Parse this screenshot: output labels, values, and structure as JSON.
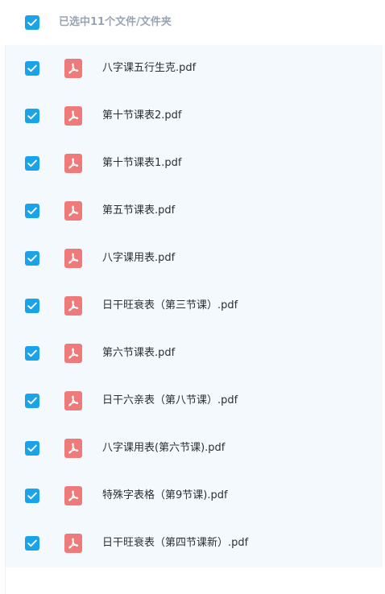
{
  "header": {
    "selection_text": "已选中11个文件/文件夹",
    "all_checked": true
  },
  "files": [
    {
      "name": "八字课五行生克.pdf",
      "checked": true,
      "icon": "pdf-icon"
    },
    {
      "name": "第十节课表2.pdf",
      "checked": true,
      "icon": "pdf-icon"
    },
    {
      "name": "第十节课表1.pdf",
      "checked": true,
      "icon": "pdf-icon"
    },
    {
      "name": "第五节课表.pdf",
      "checked": true,
      "icon": "pdf-icon"
    },
    {
      "name": "八字课用表.pdf",
      "checked": true,
      "icon": "pdf-icon"
    },
    {
      "name": "日干旺衰表（第三节课）.pdf",
      "checked": true,
      "icon": "pdf-icon"
    },
    {
      "name": "第六节课表.pdf",
      "checked": true,
      "icon": "pdf-icon"
    },
    {
      "name": "日干六亲表（第八节课）.pdf",
      "checked": true,
      "icon": "pdf-icon"
    },
    {
      "name": "八字课用表(第六节课).pdf",
      "checked": true,
      "icon": "pdf-icon"
    },
    {
      "name": "特殊字表格（第9节课).pdf",
      "checked": true,
      "icon": "pdf-icon"
    },
    {
      "name": "日干旺衰表（第四节课新）.pdf",
      "checked": true,
      "icon": "pdf-icon"
    }
  ],
  "colors": {
    "checkbox": "#1aa3e8",
    "pdf_icon": "#ee7a79",
    "list_background": "#f4f9fe",
    "header_text": "#9aa4b1"
  }
}
